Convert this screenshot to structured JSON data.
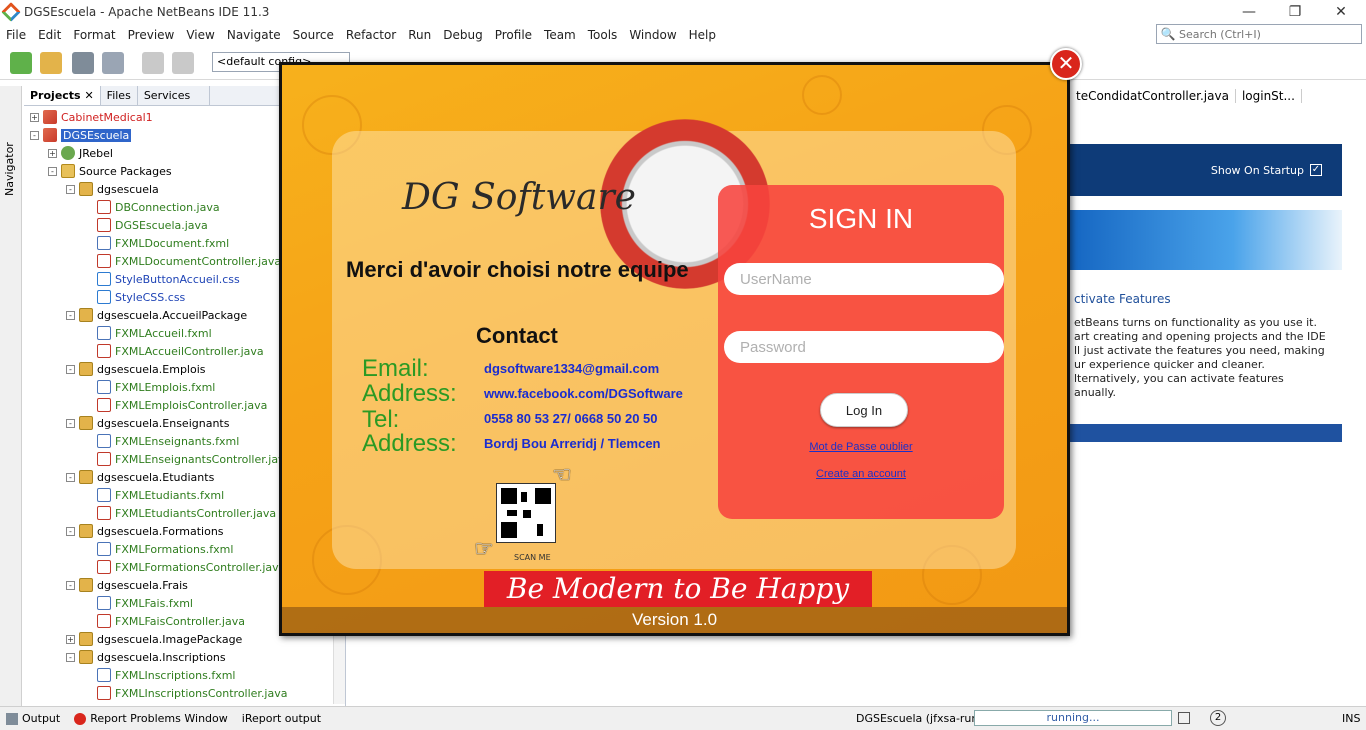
{
  "window": {
    "title": "DGSEscuela - Apache NetBeans IDE 11.3"
  },
  "menu": [
    "File",
    "Edit",
    "Format",
    "Preview",
    "View",
    "Navigate",
    "Source",
    "Refactor",
    "Run",
    "Debug",
    "Profile",
    "Team",
    "Tools",
    "Window",
    "Help"
  ],
  "search": {
    "placeholder": "Search (Ctrl+I)"
  },
  "toolbar": {
    "config": "<default config>"
  },
  "navigator": {
    "label": "Navigator"
  },
  "project_tabs": [
    "Projects",
    "Files",
    "Services"
  ],
  "tree": [
    {
      "label": "CabinetMedical1",
      "type": "proj",
      "level": 0,
      "exp": "+",
      "color": "red"
    },
    {
      "label": "DGSEscuela",
      "type": "proj",
      "level": 0,
      "exp": "-",
      "color": "sel"
    },
    {
      "label": "JRebel",
      "type": "jr",
      "level": 1,
      "exp": "+",
      "color": ""
    },
    {
      "label": "Source Packages",
      "type": "src",
      "level": 1,
      "exp": "-",
      "color": ""
    },
    {
      "label": "dgsescuela",
      "type": "pkg",
      "level": 2,
      "exp": "-",
      "color": ""
    },
    {
      "label": "DBConnection.java",
      "type": "java",
      "level": 3,
      "exp": "",
      "color": "green"
    },
    {
      "label": "DGSEscuela.java",
      "type": "java",
      "level": 3,
      "exp": "",
      "color": "green"
    },
    {
      "label": "FXMLDocument.fxml",
      "type": "fxml",
      "level": 3,
      "exp": "",
      "color": "green"
    },
    {
      "label": "FXMLDocumentController.java",
      "type": "java",
      "level": 3,
      "exp": "",
      "color": "green"
    },
    {
      "label": "StyleButtonAccueil.css",
      "type": "css",
      "level": 3,
      "exp": "",
      "color": "blue"
    },
    {
      "label": "StyleCSS.css",
      "type": "css",
      "level": 3,
      "exp": "",
      "color": "blue"
    },
    {
      "label": "dgsescuela.AccueilPackage",
      "type": "pkg",
      "level": 2,
      "exp": "-",
      "color": ""
    },
    {
      "label": "FXMLAccueil.fxml",
      "type": "fxml",
      "level": 3,
      "exp": "",
      "color": "green"
    },
    {
      "label": "FXMLAccueilController.java",
      "type": "java",
      "level": 3,
      "exp": "",
      "color": "green"
    },
    {
      "label": "dgsescuela.Emplois",
      "type": "pkg",
      "level": 2,
      "exp": "-",
      "color": ""
    },
    {
      "label": "FXMLEmplois.fxml",
      "type": "fxml",
      "level": 3,
      "exp": "",
      "color": "green"
    },
    {
      "label": "FXMLEmploisController.java",
      "type": "java",
      "level": 3,
      "exp": "",
      "color": "green"
    },
    {
      "label": "dgsescuela.Enseignants",
      "type": "pkg",
      "level": 2,
      "exp": "-",
      "color": ""
    },
    {
      "label": "FXMLEnseignants.fxml",
      "type": "fxml",
      "level": 3,
      "exp": "",
      "color": "green"
    },
    {
      "label": "FXMLEnseignantsController.java",
      "type": "java",
      "level": 3,
      "exp": "",
      "color": "green"
    },
    {
      "label": "dgsescuela.Etudiants",
      "type": "pkg",
      "level": 2,
      "exp": "-",
      "color": ""
    },
    {
      "label": "FXMLEtudiants.fxml",
      "type": "fxml",
      "level": 3,
      "exp": "",
      "color": "green"
    },
    {
      "label": "FXMLEtudiantsController.java",
      "type": "java",
      "level": 3,
      "exp": "",
      "color": "green"
    },
    {
      "label": "dgsescuela.Formations",
      "type": "pkg",
      "level": 2,
      "exp": "-",
      "color": ""
    },
    {
      "label": "FXMLFormations.fxml",
      "type": "fxml",
      "level": 3,
      "exp": "",
      "color": "green"
    },
    {
      "label": "FXMLFormationsController.java",
      "type": "java",
      "level": 3,
      "exp": "",
      "color": "green"
    },
    {
      "label": "dgsescuela.Frais",
      "type": "pkg",
      "level": 2,
      "exp": "-",
      "color": ""
    },
    {
      "label": "FXMLFais.fxml",
      "type": "fxml",
      "level": 3,
      "exp": "",
      "color": "green"
    },
    {
      "label": "FXMLFaisController.java",
      "type": "java",
      "level": 3,
      "exp": "",
      "color": "green"
    },
    {
      "label": "dgsescuela.ImagePackage",
      "type": "pkg",
      "level": 2,
      "exp": "+",
      "color": ""
    },
    {
      "label": "dgsescuela.Inscriptions",
      "type": "pkg",
      "level": 2,
      "exp": "-",
      "color": ""
    },
    {
      "label": "FXMLInscriptions.fxml",
      "type": "fxml",
      "level": 3,
      "exp": "",
      "color": "green"
    },
    {
      "label": "FXMLInscriptionsController.java",
      "type": "java",
      "level": 3,
      "exp": "",
      "color": "green"
    }
  ],
  "editor": {
    "tabs": [
      "teCondidatController.java",
      "loginSt..."
    ],
    "startpage": {
      "show_on_startup": "Show On Startup",
      "link": "ctivate Features",
      "body": [
        "etBeans turns on functionality as you use it.",
        "art creating and opening projects and the IDE",
        "ll just activate the features you need, making",
        "ur experience quicker and cleaner.",
        "lternatively, you can activate features",
        "anually."
      ]
    }
  },
  "statusbar": {
    "output": "Output",
    "problems": "Report Problems Window",
    "ireport": "iReport output",
    "run": "DGSEscuela (jfxsa-run)",
    "progress": "running...",
    "ins": "INS"
  },
  "splash": {
    "logo": "DG Software",
    "tagline": "Merci d'avoir choisi notre equipe",
    "contact_heading": "Contact",
    "contacts": [
      {
        "label": "Email:",
        "value": "dgsoftware1334@gmail.com"
      },
      {
        "label": "Address:",
        "value": "www.facebook.com/DGSoftware"
      },
      {
        "label": "Tel:",
        "value": "0558 80 53 27/ 0668 50 20 50"
      },
      {
        "label": "Address:",
        "value": "Bordj Bou Arreridj / Tlemcen"
      }
    ],
    "scan_me": "SCAN ME",
    "signin": {
      "title": "SIGN IN",
      "username_placeholder": "UserName",
      "password_placeholder": "Password",
      "login": "Log In",
      "forgot": "Mot de Passe oublier",
      "create": "Create an account"
    },
    "slogan": "Be Modern to Be Happy",
    "version": "Version 1.0"
  }
}
